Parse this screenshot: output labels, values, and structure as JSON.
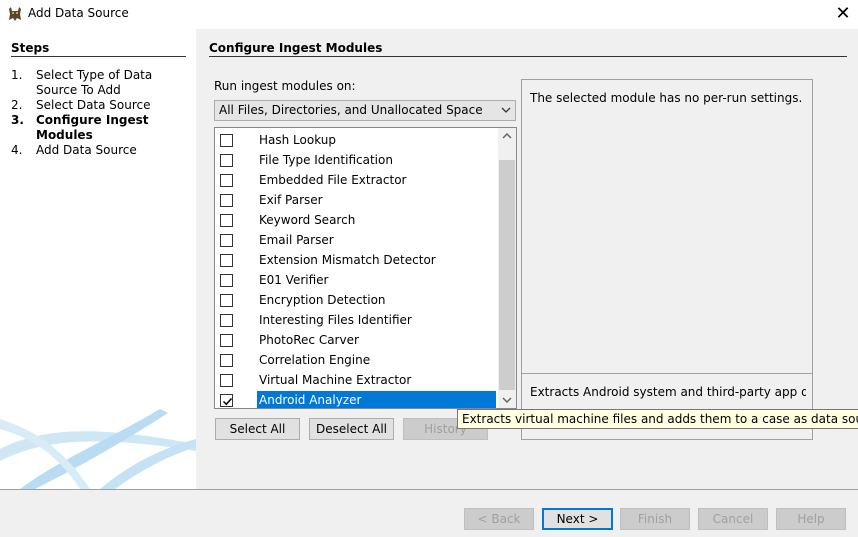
{
  "window": {
    "title": "Add Data Source",
    "close_glyph": "✕"
  },
  "steps": {
    "heading": "Steps",
    "items": [
      {
        "num": "1.",
        "label": "Select Type of Data Source To Add",
        "current": false
      },
      {
        "num": "2.",
        "label": "Select Data Source",
        "current": false
      },
      {
        "num": "3.",
        "label": "Configure Ingest Modules",
        "current": true
      },
      {
        "num": "4.",
        "label": "Add Data Source",
        "current": false
      }
    ]
  },
  "main": {
    "heading": "Configure Ingest Modules",
    "run_on_label": "Run ingest modules on:",
    "run_on_value": "All Files, Directories, and Unallocated Space",
    "modules": [
      {
        "label": "Hash Lookup",
        "checked": false,
        "selected": false
      },
      {
        "label": "File Type Identification",
        "checked": false,
        "selected": false
      },
      {
        "label": "Embedded File Extractor",
        "checked": false,
        "selected": false
      },
      {
        "label": "Exif Parser",
        "checked": false,
        "selected": false
      },
      {
        "label": "Keyword Search",
        "checked": false,
        "selected": false
      },
      {
        "label": "Email Parser",
        "checked": false,
        "selected": false
      },
      {
        "label": "Extension Mismatch Detector",
        "checked": false,
        "selected": false
      },
      {
        "label": "E01 Verifier",
        "checked": false,
        "selected": false
      },
      {
        "label": "Encryption Detection",
        "checked": false,
        "selected": false
      },
      {
        "label": "Interesting Files Identifier",
        "checked": false,
        "selected": false
      },
      {
        "label": "PhotoRec Carver",
        "checked": false,
        "selected": false
      },
      {
        "label": "Correlation Engine",
        "checked": false,
        "selected": false
      },
      {
        "label": "Virtual Machine Extractor",
        "checked": false,
        "selected": false
      },
      {
        "label": "Android Analyzer",
        "checked": true,
        "selected": true
      }
    ],
    "buttons": {
      "select_all": "Select All",
      "deselect_all": "Deselect All",
      "history": "History"
    },
    "settings_message": "The selected module has no per-run settings.",
    "module_description": "Extracts Android system and third-party app d...",
    "tooltip": "Extracts virtual machine files and adds them to a case as data sources."
  },
  "footer": {
    "back": "< Back",
    "next": "Next >",
    "finish": "Finish",
    "cancel": "Cancel",
    "help": "Help"
  },
  "colors": {
    "selection": "#0078d7",
    "tooltip_bg": "#ffffe1",
    "panel_bg": "#f0f0f0"
  }
}
